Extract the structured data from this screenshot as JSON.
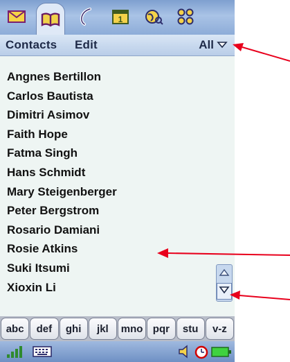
{
  "apptabs": [
    {
      "name": "messaging-icon"
    },
    {
      "name": "contacts-book-icon",
      "active": true
    },
    {
      "name": "phone-icon"
    },
    {
      "name": "calendar-icon",
      "day": "1"
    },
    {
      "name": "web-browser-icon"
    },
    {
      "name": "applications-grid-icon"
    }
  ],
  "menubar": {
    "contacts": "Contacts",
    "edit": "Edit",
    "filter": "All"
  },
  "contacts": [
    "Angnes Bertillon",
    "Carlos Bautista",
    "Dimitri Asimov",
    "Faith Hope",
    "Fatma Singh",
    "Hans Schmidt",
    "Mary Steigenberger",
    "Peter Bergstrom",
    "Rosario Damiani",
    "Rosie Atkins",
    "Suki Itsumi",
    "Xioxin Li"
  ],
  "keys": [
    "abc",
    "def",
    "ghi",
    "jkl",
    "mno",
    "pqr",
    "stu",
    "v-z"
  ],
  "colors": {
    "annotation": "#e8001c",
    "accent": "#1e2a48"
  }
}
